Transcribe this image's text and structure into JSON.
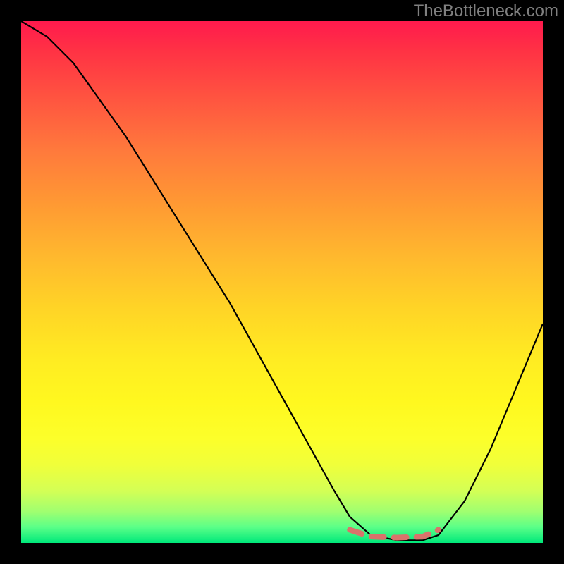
{
  "watermark": "TheBottleneck.com",
  "chart_data": {
    "type": "line",
    "title": "",
    "xlabel": "",
    "ylabel": "",
    "xlim": [
      0,
      100
    ],
    "ylim": [
      0,
      100
    ],
    "annotations": [
      "Background gradient: red (top) → orange → yellow → green (bottom), representing bottleneck severity"
    ],
    "series": [
      {
        "name": "bottleneck-curve",
        "color": "#000000",
        "x": [
          0,
          5,
          10,
          15,
          20,
          25,
          30,
          35,
          40,
          45,
          50,
          55,
          60,
          63,
          67,
          72,
          77,
          80,
          85,
          90,
          95,
          100
        ],
        "y": [
          100,
          97,
          92,
          85,
          78,
          70,
          62,
          54,
          46,
          37,
          28,
          19,
          10,
          5,
          1.5,
          0.5,
          0.5,
          1.5,
          8,
          18,
          30,
          42
        ]
      },
      {
        "name": "optimal-range-marker",
        "color": "#d9736b",
        "style": "dashed-thick",
        "x": [
          63,
          67,
          72,
          77,
          80
        ],
        "y": [
          2.5,
          1.2,
          1.0,
          1.2,
          2.5
        ]
      }
    ],
    "gradient_stops": [
      {
        "pos": 0,
        "color": "#ff1a4d"
      },
      {
        "pos": 50,
        "color": "#ffd426"
      },
      {
        "pos": 85,
        "color": "#f0ff3a"
      },
      {
        "pos": 100,
        "color": "#00e87a"
      }
    ]
  }
}
